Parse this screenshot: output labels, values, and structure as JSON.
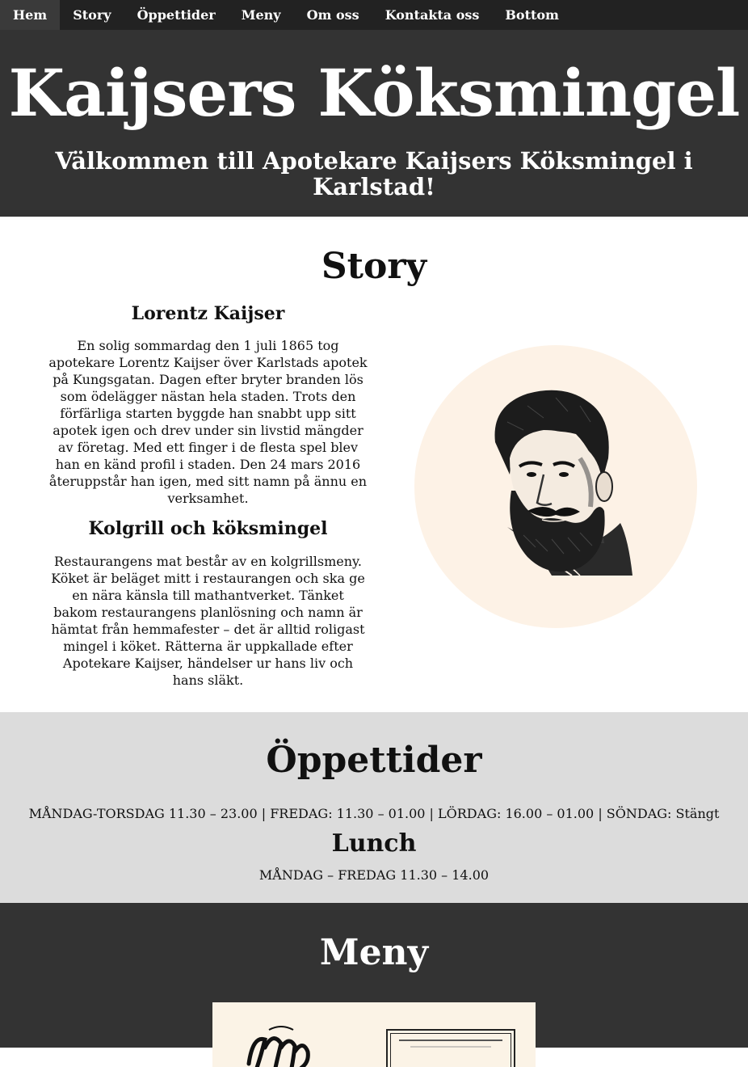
{
  "nav": {
    "items": [
      {
        "label": "Hem",
        "active": true
      },
      {
        "label": "Story",
        "active": false
      },
      {
        "label": "Öppettider",
        "active": false
      },
      {
        "label": "Meny",
        "active": false
      },
      {
        "label": "Om oss",
        "active": false
      },
      {
        "label": "Kontakta oss",
        "active": false
      },
      {
        "label": "Bottom",
        "active": false
      }
    ]
  },
  "header": {
    "title": "Kaijsers Köksmingel",
    "subtitle": "Välkommen till Apotekare Kaijsers Köksmingel i Karlstad!"
  },
  "story": {
    "title": "Story",
    "sections": [
      {
        "heading": "Lorentz Kaijser",
        "text": "En solig sommardag den 1 juli 1865 tog apotekare Lorentz Kaijser över Karlstads apotek på Kungsgatan. Dagen efter bryter branden lös som ödelägger nästan hela staden. Trots den förfärliga starten byggde han snabbt upp sitt apotek igen och drev under sin livstid mängder av företag. Med ett finger i de flesta spel blev han en känd profil i staden. Den 24 mars 2016 återuppstår han igen, med sitt namn på ännu en verksamhet."
      },
      {
        "heading": "Kolgrill och köksmingel",
        "text": "Restaurangens mat består av en kolgrillsmeny. Köket är beläget mitt i restaurangen och ska ge en nära känsla till mathantverket. Tänket bakom restaurangens planlösning och namn är hämtat från hemmafester – det är alltid roligast mingel i köket. Rätterna är uppkallade efter Apotekare Kaijser, händelser ur hans liv och hans släkt."
      }
    ]
  },
  "hours": {
    "title": "Öppettider",
    "schedule": "MÅNDAG-TORSDAG 11.30 – 23.00 | FREDAG: 11.30 – 01.00 | LÖRDAG: 16.00 – 01.00 | SÖNDAG: Stängt",
    "lunch_title": "Lunch",
    "lunch_schedule": "MÅNDAG – FREDAG 11.30 – 14.00"
  },
  "menu": {
    "title": "Meny"
  },
  "colors": {
    "nav_bg": "#222222",
    "header_bg": "#333333",
    "hours_bg": "#dcdcdc",
    "portrait_bg": "#fdf2e6"
  }
}
